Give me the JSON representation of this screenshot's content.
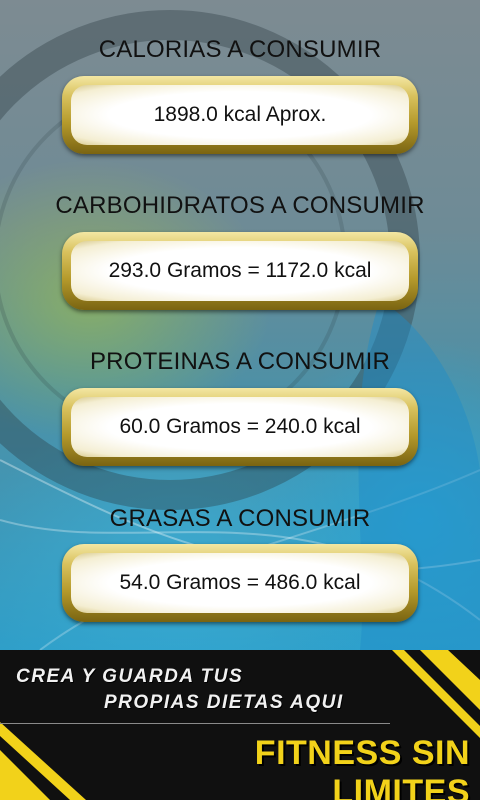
{
  "sections": [
    {
      "title": "CALORIAS A CONSUMIR",
      "value": "1898.0 kcal Aprox."
    },
    {
      "title": "CARBOHIDRATOS A CONSUMIR",
      "value": "293.0 Gramos = 1172.0 kcal"
    },
    {
      "title": "PROTEINAS A CONSUMIR",
      "value": "60.0 Gramos = 240.0 kcal"
    },
    {
      "title": "GRASAS A CONSUMIR",
      "value": "54.0 Gramos = 486.0 kcal"
    }
  ],
  "banner": {
    "line1": "CREA Y GUARDA TUS",
    "line2": "PROPIAS DIETAS AQUI",
    "brand": "FITNESS SIN LIMITES"
  },
  "colors": {
    "accent_gold": "#d9c25e",
    "banner_brand": "#f2d21a",
    "banner_stripe": "#f2d21a"
  }
}
